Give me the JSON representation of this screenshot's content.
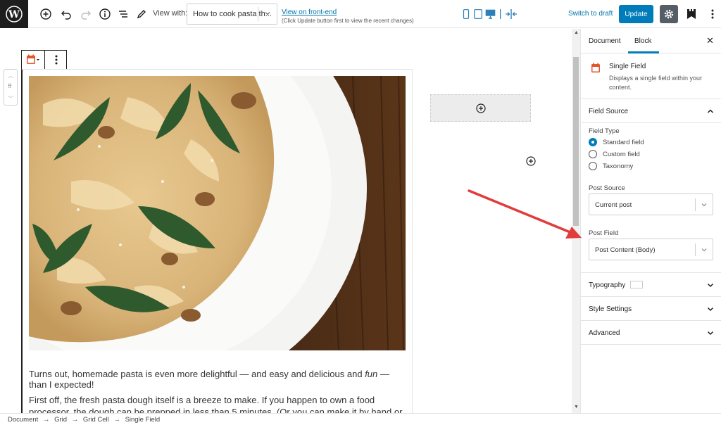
{
  "toolbar": {
    "view_with_label": "View with:",
    "view_select_value": "How to cook pasta th...",
    "front_link": "View on front-end",
    "front_note": "(Click Update button first to view the recent changes)",
    "switch_draft": "Switch to draft",
    "update_label": "Update"
  },
  "content": {
    "paragraph1_a": "Turns out, homemade pasta is even more delightful — and easy and delicious and ",
    "paragraph1_em": "fun",
    "paragraph1_b": " — than I expected!",
    "paragraph2": "First off, the fresh pasta dough itself is a breeze to make.  If you happen to own a food processor, the dough can be prepped in less than 5 minutes.  (Or you can make it by hand or in a stand mixer in less"
  },
  "sidebar": {
    "tabs": [
      {
        "label": "Document"
      },
      {
        "label": "Block"
      }
    ],
    "active_tab": "Block",
    "block": {
      "title": "Single Field",
      "description": "Displays a single field within your content."
    },
    "field_source": {
      "title": "Field Source",
      "field_type_label": "Field Type",
      "options": [
        {
          "label": "Standard field",
          "checked": true
        },
        {
          "label": "Custom field",
          "checked": false
        },
        {
          "label": "Taxonomy",
          "checked": false
        }
      ],
      "post_source_label": "Post Source",
      "post_source_value": "Current post",
      "post_field_label": "Post Field",
      "post_field_value": "Post Content (Body)"
    },
    "panels": [
      {
        "title": "Typography"
      },
      {
        "title": "Style Settings"
      },
      {
        "title": "Advanced"
      }
    ]
  },
  "breadcrumb": [
    "Document",
    "→",
    "Grid",
    "→",
    "Grid Cell",
    "→",
    "Single Field"
  ],
  "colors": {
    "accent": "#007cba",
    "arrow": "#e23b3b",
    "block_icon": "#e2552c"
  }
}
